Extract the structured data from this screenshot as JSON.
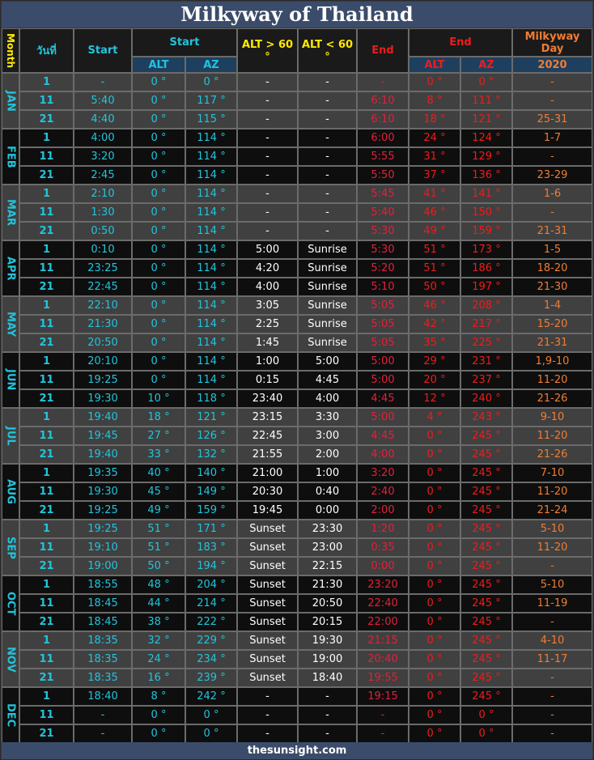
{
  "title": "Milkyway of Thailand",
  "footer": "thesunsight.com",
  "colors": {
    "title_bg": "#3b4c6a",
    "cyan": "#22c4dc",
    "yellow": "#ffea00",
    "red": "#ee1c1c",
    "orange": "#ef7d33",
    "row_grey": "#404040",
    "row_black": "#0e0e0e"
  },
  "headers": {
    "month": "Month",
    "day": "วันที่",
    "start_time": "Start",
    "start_group": "Start",
    "start_alt": "ALT",
    "start_az": "AZ",
    "alt_gt60": "ALT > 60 °",
    "alt_lt60": "ALT < 60 °",
    "end_time": "End",
    "end_group": "End",
    "end_alt": "ALT",
    "end_az": "AZ",
    "mw_day": "Milkyway Day",
    "mw_year": "2020"
  },
  "months": [
    {
      "name": "JAN",
      "rows": [
        {
          "day": "1",
          "start": "-",
          "salt": "0 °",
          "saz": "0 °",
          "gt60": "-",
          "lt60": "-",
          "end": "-",
          "ealt": "0 °",
          "eaz": "0 °",
          "mw": "-"
        },
        {
          "day": "11",
          "start": "5:40",
          "salt": "0 °",
          "saz": "117 °",
          "gt60": "-",
          "lt60": "-",
          "end": "6:10",
          "ealt": "8 °",
          "eaz": "111 °",
          "mw": "-"
        },
        {
          "day": "21",
          "start": "4:40",
          "salt": "0 °",
          "saz": "115 °",
          "gt60": "-",
          "lt60": "-",
          "end": "6:10",
          "ealt": "18 °",
          "eaz": "121 °",
          "mw": "25-31"
        }
      ]
    },
    {
      "name": "FEB",
      "rows": [
        {
          "day": "1",
          "start": "4:00",
          "salt": "0 °",
          "saz": "114 °",
          "gt60": "-",
          "lt60": "-",
          "end": "6:00",
          "ealt": "24 °",
          "eaz": "124 °",
          "mw": "1-7"
        },
        {
          "day": "11",
          "start": "3:20",
          "salt": "0 °",
          "saz": "114 °",
          "gt60": "-",
          "lt60": "-",
          "end": "5:55",
          "ealt": "31 °",
          "eaz": "129 °",
          "mw": "-"
        },
        {
          "day": "21",
          "start": "2:45",
          "salt": "0 °",
          "saz": "114 °",
          "gt60": "-",
          "lt60": "-",
          "end": "5:50",
          "ealt": "37 °",
          "eaz": "136 °",
          "mw": "23-29"
        }
      ]
    },
    {
      "name": "MAR",
      "rows": [
        {
          "day": "1",
          "start": "2:10",
          "salt": "0 °",
          "saz": "114 °",
          "gt60": "-",
          "lt60": "-",
          "end": "5:45",
          "ealt": "41 °",
          "eaz": "141 °",
          "mw": "1-6"
        },
        {
          "day": "11",
          "start": "1:30",
          "salt": "0 °",
          "saz": "114 °",
          "gt60": "-",
          "lt60": "-",
          "end": "5:40",
          "ealt": "46 °",
          "eaz": "150 °",
          "mw": "-"
        },
        {
          "day": "21",
          "start": "0:50",
          "salt": "0 °",
          "saz": "114 °",
          "gt60": "-",
          "lt60": "-",
          "end": "5:30",
          "ealt": "49 °",
          "eaz": "159 °",
          "mw": "21-31"
        }
      ]
    },
    {
      "name": "APR",
      "rows": [
        {
          "day": "1",
          "start": "0:10",
          "salt": "0 °",
          "saz": "114 °",
          "gt60": "5:00",
          "lt60": "Sunrise",
          "end": "5:30",
          "ealt": "51 °",
          "eaz": "173 °",
          "mw": "1-5"
        },
        {
          "day": "11",
          "start": "23:25",
          "salt": "0 °",
          "saz": "114 °",
          "gt60": "4:20",
          "lt60": "Sunrise",
          "end": "5:20",
          "ealt": "51 °",
          "eaz": "186 °",
          "mw": "18-20"
        },
        {
          "day": "21",
          "start": "22:45",
          "salt": "0 °",
          "saz": "114 °",
          "gt60": "4:00",
          "lt60": "Sunrise",
          "end": "5:10",
          "ealt": "50 °",
          "eaz": "197 °",
          "mw": "21-30"
        }
      ]
    },
    {
      "name": "MAY",
      "rows": [
        {
          "day": "1",
          "start": "22:10",
          "salt": "0 °",
          "saz": "114 °",
          "gt60": "3:05",
          "lt60": "Sunrise",
          "end": "5:05",
          "ealt": "46 °",
          "eaz": "208 °",
          "mw": "1-4"
        },
        {
          "day": "11",
          "start": "21:30",
          "salt": "0 °",
          "saz": "114 °",
          "gt60": "2:25",
          "lt60": "Sunrise",
          "end": "5:05",
          "ealt": "42 °",
          "eaz": "217 °",
          "mw": "15-20"
        },
        {
          "day": "21",
          "start": "20:50",
          "salt": "0 °",
          "saz": "114 °",
          "gt60": "1:45",
          "lt60": "Sunrise",
          "end": "5:05",
          "ealt": "35 °",
          "eaz": "225 °",
          "mw": "21-31"
        }
      ]
    },
    {
      "name": "JUN",
      "rows": [
        {
          "day": "1",
          "start": "20:10",
          "salt": "0 °",
          "saz": "114 °",
          "gt60": "1:00",
          "lt60": "5:00",
          "end": "5:00",
          "ealt": "29 °",
          "eaz": "231 °",
          "mw": "1,9-10"
        },
        {
          "day": "11",
          "start": "19:25",
          "salt": "0 °",
          "saz": "114 °",
          "gt60": "0:15",
          "lt60": "4:45",
          "end": "5:00",
          "ealt": "20 °",
          "eaz": "237 °",
          "mw": "11-20"
        },
        {
          "day": "21",
          "start": "19:30",
          "salt": "10 °",
          "saz": "118 °",
          "gt60": "23:40",
          "lt60": "4:00",
          "end": "4:45",
          "ealt": "12 °",
          "eaz": "240 °",
          "mw": "21-26"
        }
      ]
    },
    {
      "name": "JUL",
      "rows": [
        {
          "day": "1",
          "start": "19:40",
          "salt": "18 °",
          "saz": "121 °",
          "gt60": "23:15",
          "lt60": "3:30",
          "end": "5:00",
          "ealt": "4 °",
          "eaz": "243 °",
          "mw": "9-10"
        },
        {
          "day": "11",
          "start": "19:45",
          "salt": "27 °",
          "saz": "126 °",
          "gt60": "22:45",
          "lt60": "3:00",
          "end": "4:45",
          "ealt": "0 °",
          "eaz": "245 °",
          "mw": "11-20"
        },
        {
          "day": "21",
          "start": "19:40",
          "salt": "33 °",
          "saz": "132 °",
          "gt60": "21:55",
          "lt60": "2:00",
          "end": "4:00",
          "ealt": "0 °",
          "eaz": "245 °",
          "mw": "21-26"
        }
      ]
    },
    {
      "name": "AUG",
      "rows": [
        {
          "day": "1",
          "start": "19:35",
          "salt": "40 °",
          "saz": "140 °",
          "gt60": "21:00",
          "lt60": "1:00",
          "end": "3:20",
          "ealt": "0 °",
          "eaz": "245 °",
          "mw": "7-10"
        },
        {
          "day": "11",
          "start": "19:30",
          "salt": "45 °",
          "saz": "149 °",
          "gt60": "20:30",
          "lt60": "0:40",
          "end": "2:40",
          "ealt": "0 °",
          "eaz": "245 °",
          "mw": "11-20"
        },
        {
          "day": "21",
          "start": "19:25",
          "salt": "49 °",
          "saz": "159 °",
          "gt60": "19:45",
          "lt60": "0:00",
          "end": "2:00",
          "ealt": "0 °",
          "eaz": "245 °",
          "mw": "21-24"
        }
      ]
    },
    {
      "name": "SEP",
      "rows": [
        {
          "day": "1",
          "start": "19:25",
          "salt": "51 °",
          "saz": "171 °",
          "gt60": "Sunset",
          "lt60": "23:30",
          "end": "1:20",
          "ealt": "0 °",
          "eaz": "245 °",
          "mw": "5-10"
        },
        {
          "day": "11",
          "start": "19:10",
          "salt": "51 °",
          "saz": "183 °",
          "gt60": "Sunset",
          "lt60": "23:00",
          "end": "0:35",
          "ealt": "0 °",
          "eaz": "245 °",
          "mw": "11-20"
        },
        {
          "day": "21",
          "start": "19:00",
          "salt": "50 °",
          "saz": "194 °",
          "gt60": "Sunset",
          "lt60": "22:15",
          "end": "0:00",
          "ealt": "0 °",
          "eaz": "245 °",
          "mw": "-"
        }
      ]
    },
    {
      "name": "OCT",
      "rows": [
        {
          "day": "1",
          "start": "18:55",
          "salt": "48 °",
          "saz": "204 °",
          "gt60": "Sunset",
          "lt60": "21:30",
          "end": "23:20",
          "ealt": "0 °",
          "eaz": "245 °",
          "mw": "5-10"
        },
        {
          "day": "11",
          "start": "18:45",
          "salt": "44 °",
          "saz": "214 °",
          "gt60": "Sunset",
          "lt60": "20:50",
          "end": "22:40",
          "ealt": "0 °",
          "eaz": "245 °",
          "mw": "11-19"
        },
        {
          "day": "21",
          "start": "18:45",
          "salt": "38 °",
          "saz": "222 °",
          "gt60": "Sunset",
          "lt60": "20:15",
          "end": "22:00",
          "ealt": "0 °",
          "eaz": "245 °",
          "mw": "-"
        }
      ]
    },
    {
      "name": "NOV",
      "rows": [
        {
          "day": "1",
          "start": "18:35",
          "salt": "32 °",
          "saz": "229 °",
          "gt60": "Sunset",
          "lt60": "19:30",
          "end": "21:15",
          "ealt": "0 °",
          "eaz": "245 °",
          "mw": "4-10"
        },
        {
          "day": "11",
          "start": "18:35",
          "salt": "24 °",
          "saz": "234 °",
          "gt60": "Sunset",
          "lt60": "19:00",
          "end": "20:40",
          "ealt": "0 °",
          "eaz": "245 °",
          "mw": "11-17"
        },
        {
          "day": "21",
          "start": "18:35",
          "salt": "16 °",
          "saz": "239 °",
          "gt60": "Sunset",
          "lt60": "18:40",
          "end": "19:55",
          "ealt": "0 °",
          "eaz": "245 °",
          "mw": "-"
        }
      ]
    },
    {
      "name": "DEC",
      "rows": [
        {
          "day": "1",
          "start": "18:40",
          "salt": "8 °",
          "saz": "242 °",
          "gt60": "-",
          "lt60": "-",
          "end": "19:15",
          "ealt": "0 °",
          "eaz": "245 °",
          "mw": "-"
        },
        {
          "day": "11",
          "start": "-",
          "salt": "0 °",
          "saz": "0 °",
          "gt60": "-",
          "lt60": "-",
          "end": "-",
          "ealt": "0 °",
          "eaz": "0 °",
          "mw": "-"
        },
        {
          "day": "21",
          "start": "-",
          "salt": "0 °",
          "saz": "0 °",
          "gt60": "-",
          "lt60": "-",
          "end": "-",
          "ealt": "0 °",
          "eaz": "0 °",
          "mw": "-"
        }
      ]
    }
  ]
}
